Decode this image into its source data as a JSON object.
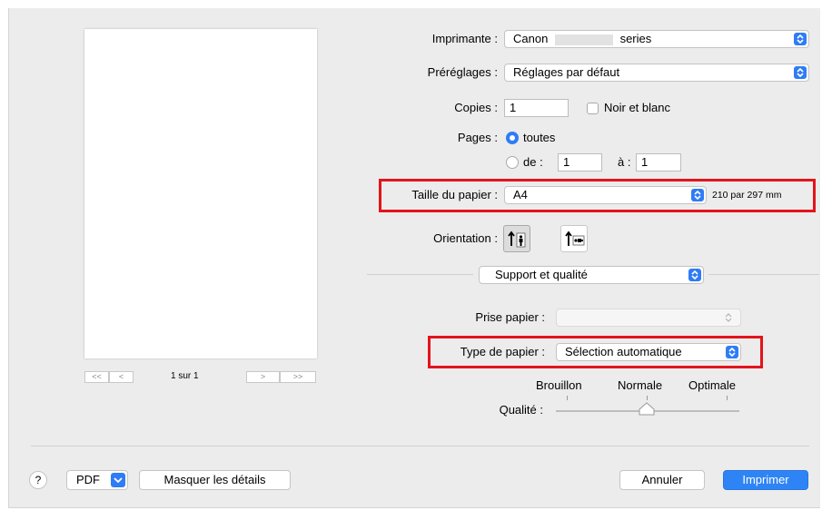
{
  "printer": {
    "label": "Imprimante :",
    "value_prefix": "Canon",
    "value_suffix": "series"
  },
  "presets": {
    "label": "Préréglages :",
    "value": "Réglages par défaut"
  },
  "copies": {
    "label": "Copies :",
    "value": "1",
    "bw_label": "Noir et blanc",
    "bw_checked": false
  },
  "pages": {
    "label": "Pages :",
    "all_label": "toutes",
    "from_label": "de :",
    "from_value": "1",
    "to_label": "à :",
    "to_value": "1",
    "selected": "all"
  },
  "paper_size": {
    "label": "Taille du papier :",
    "value": "A4",
    "dimensions": "210 par 297 mm"
  },
  "orientation": {
    "label": "Orientation :",
    "selected": "portrait",
    "portrait_icon": "portrait-orientation-icon",
    "landscape_icon": "landscape-orientation-icon"
  },
  "section": {
    "value": "Support et qualité"
  },
  "paper_source": {
    "label": "Prise papier :",
    "value": ""
  },
  "paper_type": {
    "label": "Type de papier :",
    "value": "Sélection automatique"
  },
  "quality": {
    "label": "Qualité :",
    "levels": [
      "Brouillon",
      "Normale",
      "Optimale"
    ],
    "selected": "Normale"
  },
  "preview": {
    "page_indicator": "1 sur 1",
    "first_label": "<<",
    "prev_label": "<",
    "next_label": ">",
    "last_label": ">>"
  },
  "footer": {
    "help_label": "?",
    "pdf_label": "PDF",
    "hide_details_label": "Masquer les détails",
    "cancel_label": "Annuler",
    "print_label": "Imprimer"
  },
  "colors": {
    "accent": "#2f7cf6",
    "highlight": "#e3141c",
    "dialog_bg": "#ececec"
  }
}
